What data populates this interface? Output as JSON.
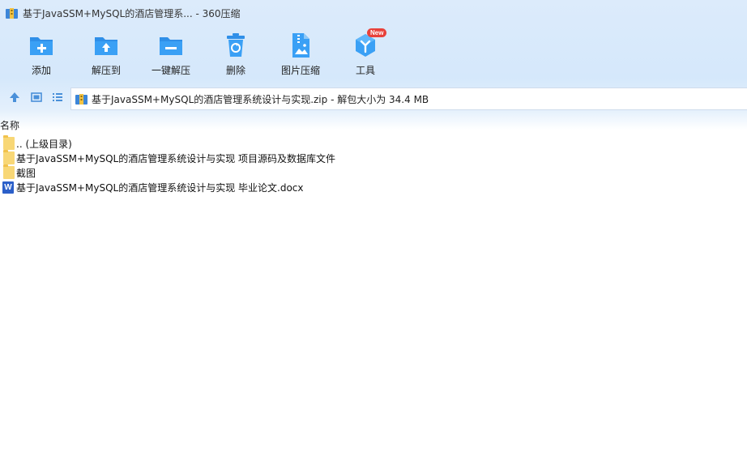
{
  "window": {
    "title": "基于JavaSSM+MySQL的酒店管理系... - 360压缩",
    "icon": "archive-icon"
  },
  "toolbar": {
    "items": [
      {
        "label": "添加",
        "icon": "add-icon"
      },
      {
        "label": "解压到",
        "icon": "extract-to-icon"
      },
      {
        "label": "一键解压",
        "icon": "one-click-extract-icon"
      },
      {
        "label": "删除",
        "icon": "delete-icon"
      },
      {
        "label": "图片压缩",
        "icon": "image-compress-icon"
      },
      {
        "label": "工具",
        "icon": "tools-icon",
        "badge": "New"
      }
    ]
  },
  "nav": {
    "up_icon": "up-arrow-icon",
    "view1_icon": "thumbnail-view-icon",
    "view2_icon": "list-view-icon",
    "address": "基于JavaSSM+MySQL的酒店管理系统设计与实现.zip - 解包大小为 34.4 MB"
  },
  "list": {
    "column_name": "名称",
    "items": [
      {
        "name": ".. (上级目录)",
        "type": "folder"
      },
      {
        "name": "基于JavaSSM+MySQL的酒店管理系统设计与实现 项目源码及数据库文件",
        "type": "folder"
      },
      {
        "name": "截图",
        "type": "folder"
      },
      {
        "name": "基于JavaSSM+MySQL的酒店管理系统设计与实现 毕业论文.docx",
        "type": "word",
        "icon_letter": "W"
      }
    ]
  },
  "colors": {
    "accent": "#2f8fe8",
    "folder": "#f8d776",
    "word": "#2b5fc9",
    "badge": "#e8413a"
  }
}
